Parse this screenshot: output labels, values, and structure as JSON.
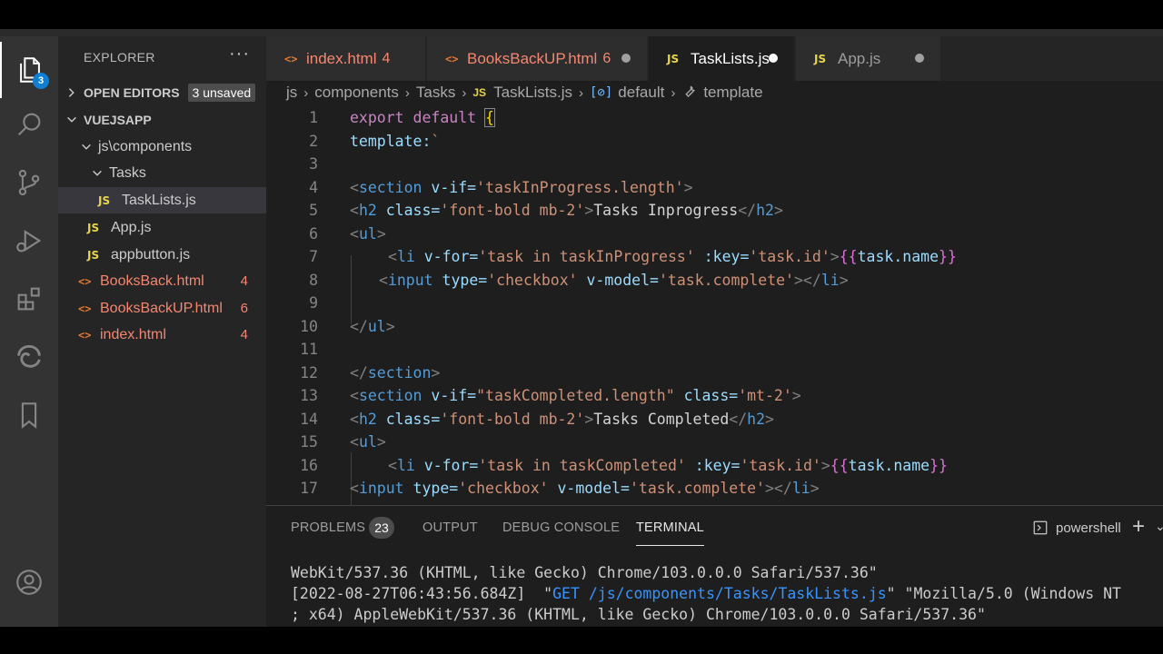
{
  "activity_bar": {
    "explorer_badge": "3",
    "items": [
      "files-icon",
      "search-icon",
      "source-control-icon",
      "run-debug-icon",
      "extensions-icon",
      "edge-icon",
      "bookmark-icon",
      "account-icon"
    ]
  },
  "sidebar": {
    "title": "EXPLORER",
    "more": "···",
    "open_editors_label": "OPEN EDITORS",
    "unsaved_badge": "3 unsaved",
    "project_label": "VUEJSAPP",
    "folder_components": "js\\components",
    "folder_tasks": "Tasks",
    "files": [
      {
        "icon": "JS",
        "name": "TaskLists.js"
      },
      {
        "icon": "JS",
        "name": "App.js"
      },
      {
        "icon": "JS",
        "name": "appbutton.js"
      },
      {
        "icon": "<>",
        "name": "BooksBack.html",
        "errors": "4"
      },
      {
        "icon": "<>",
        "name": "BooksBackUP.html",
        "errors": "6"
      },
      {
        "icon": "<>",
        "name": "index.html",
        "errors": "4"
      }
    ]
  },
  "tabs": [
    {
      "icon": "<>",
      "label": "index.html",
      "count": "4"
    },
    {
      "icon": "<>",
      "label": "BooksBackUP.html",
      "count": "6"
    },
    {
      "icon": "JS",
      "label": "TaskLists.js"
    },
    {
      "icon": "JS",
      "label": "App.js"
    }
  ],
  "breadcrumb": {
    "parts": [
      "js",
      "components",
      "Tasks"
    ],
    "file": "TaskLists.js",
    "symbol1": "default",
    "symbol2": "template"
  },
  "editor": {
    "line_numbers": [
      "1",
      "2",
      "3",
      "4",
      "5",
      "6",
      "7",
      "8",
      "9",
      "10",
      "11",
      "12",
      "13",
      "14",
      "15",
      "16",
      "17"
    ],
    "lines": {
      "l1": {
        "kw1": "export",
        "kw2": "default",
        "brace": "{"
      },
      "l2": {
        "prop": "template:",
        "tick": "`"
      },
      "l4": {
        "tag": "section",
        "attr": "v-if=",
        "val": "'taskInProgress.length'"
      },
      "l5": {
        "tag": "h2",
        "attr": "class=",
        "val": "'font-bold mb-2'",
        "text": "Tasks Inprogress",
        "close": "h2"
      },
      "l6": {
        "tag": "ul"
      },
      "l7": {
        "tag": "li",
        "attr1": "v-for=",
        "val1": "'task in taskInProgress'",
        "attr2": ":key=",
        "val2": "'task.id'",
        "open": "{{",
        "expr": "task.name",
        "close": "}}"
      },
      "l8": {
        "tag": "input",
        "attr1": "type=",
        "val1": "'checkbox'",
        "attr2": "v-model=",
        "val2": "'task.complete'",
        "close": "li"
      },
      "l10": {
        "close": "ul"
      },
      "l12": {
        "close": "section"
      },
      "l13": {
        "tag": "section",
        "attr1": "v-if=",
        "val1": "\"taskCompleted.length\"",
        "attr2": "class=",
        "val2": "'mt-2'"
      },
      "l14": {
        "tag": "h2",
        "attr": "class=",
        "val": "'font-bold mb-2'",
        "text": "Tasks Completed",
        "close": "h2"
      },
      "l15": {
        "tag": "ul"
      },
      "l16": {
        "tag": "li",
        "attr1": "v-for=",
        "val1": "'task in taskCompleted'",
        "attr2": ":key=",
        "val2": "'task.id'",
        "open": "{{",
        "expr": "task.name",
        "close": "}}"
      },
      "l17": {
        "tag": "input",
        "attr1": "type=",
        "val1": "'checkbox'",
        "attr2": "v-model=",
        "val2": "'task.complete'",
        "close": "li"
      }
    }
  },
  "panel": {
    "tabs": [
      "PROBLEMS",
      "OUTPUT",
      "DEBUG CONSOLE",
      "TERMINAL"
    ],
    "problems_count": "23",
    "shell": "powershell",
    "terminal_lines": {
      "t1": "WebKit/537.36 (KHTML, like Gecko) Chrome/103.0.0.0 Safari/537.36\"",
      "t2_pre": "[2022-08-27T06:43:56.684Z]  \"",
      "t2_get": "GET /js/components/Tasks/TaskLists.js",
      "t2_post": "\" \"Mozilla/5.0 (Windows NT",
      "t3": "; x64) AppleWebKit/537.36 (KHTML, like Gecko) Chrome/103.0.0.0 Safari/537.36\""
    }
  },
  "colors": {
    "activity_bg": "#333333",
    "sidebar_bg": "#252526",
    "editor_bg": "#1e1e1e",
    "error_red": "#f48771",
    "js_yellow": "#e8d44d",
    "badge_blue": "#0e7fd4"
  }
}
